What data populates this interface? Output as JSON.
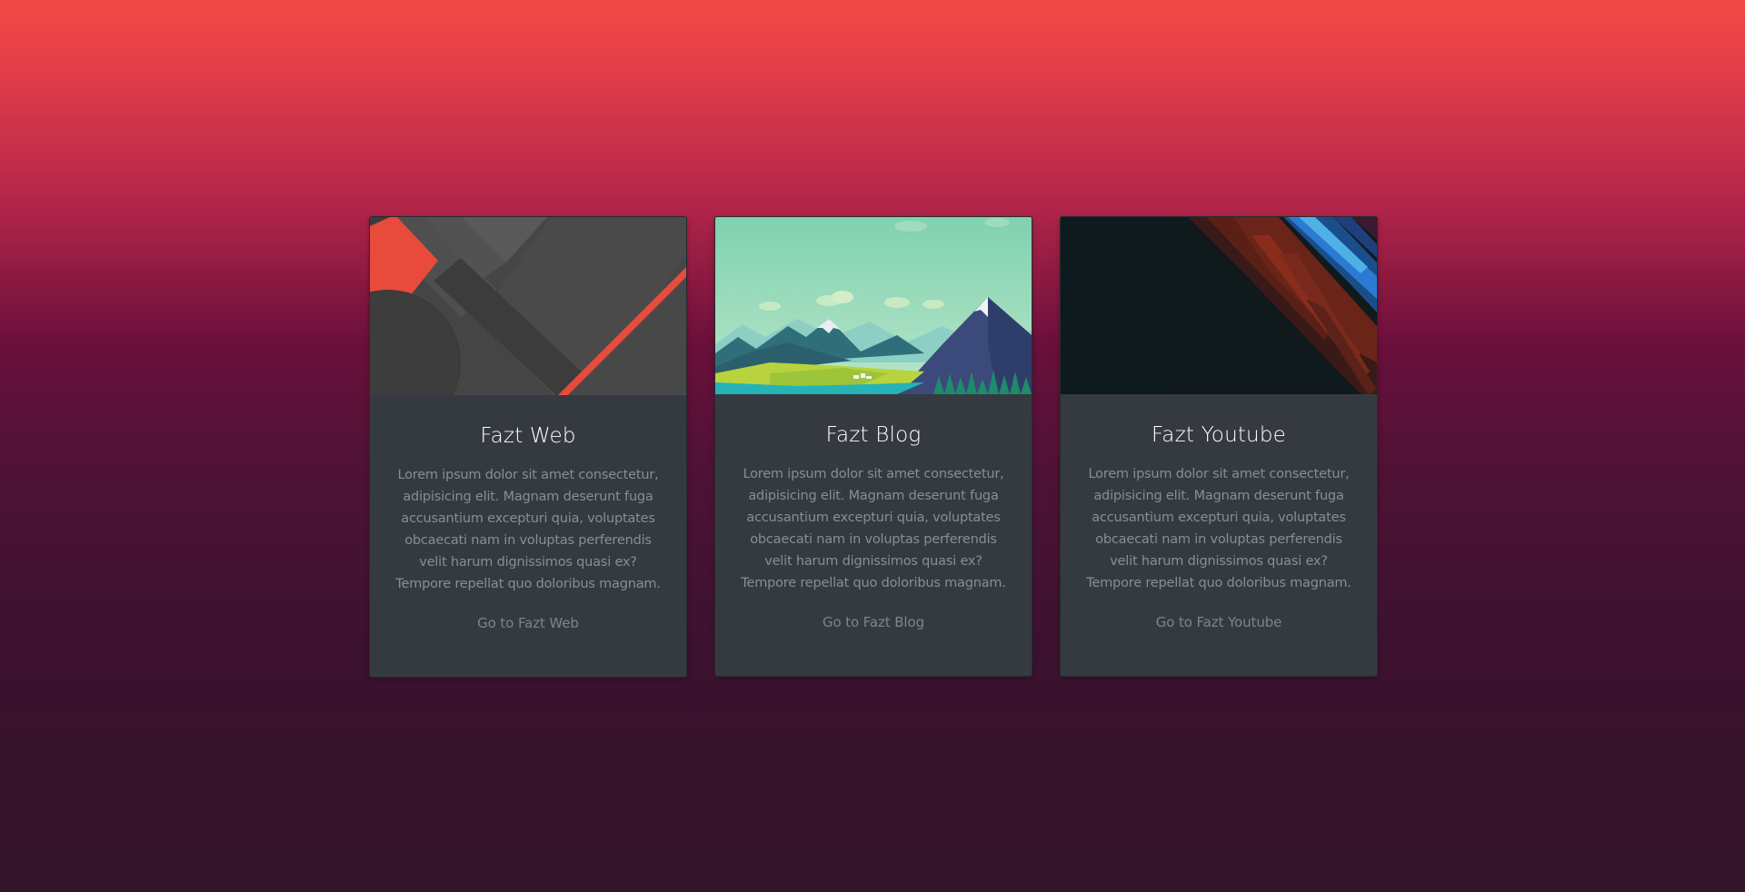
{
  "colors": {
    "background_top": "#f24a43",
    "background_bottom": "#331428",
    "card_background": "#343a40",
    "title_color": "#ffffff",
    "text_color": "#868e96",
    "link_color": "#7d848b"
  },
  "cards": [
    {
      "image": "material-design-wallpaper",
      "title": "Fazt Web",
      "text": "Lorem ipsum dolor sit amet consectetur, adipisicing elit. Magnam deserunt fuga accusantium excepturi quia, voluptates obcaecati nam in voluptas perferendis velit harum dignissimos quasi ex? Tempore repellat quo doloribus magnam.",
      "link": "Go to Fazt Web"
    },
    {
      "image": "mountain-landscape-wallpaper",
      "title": "Fazt Blog",
      "text": "Lorem ipsum dolor sit amet consectetur, adipisicing elit. Magnam deserunt fuga accusantium excepturi quia, voluptates obcaecati nam in voluptas perferendis velit harum dignissimos quasi ex? Tempore repellat quo doloribus magnam.",
      "link": "Go to Fazt Blog"
    },
    {
      "image": "dark-abstract-wallpaper",
      "title": "Fazt Youtube",
      "text": "Lorem ipsum dolor sit amet consectetur, adipisicing elit. Magnam deserunt fuga accusantium excepturi quia, voluptates obcaecati nam in voluptas perferendis velit harum dignissimos quasi ex? Tempore repellat quo doloribus magnam.",
      "link": "Go to Fazt Youtube"
    }
  ]
}
